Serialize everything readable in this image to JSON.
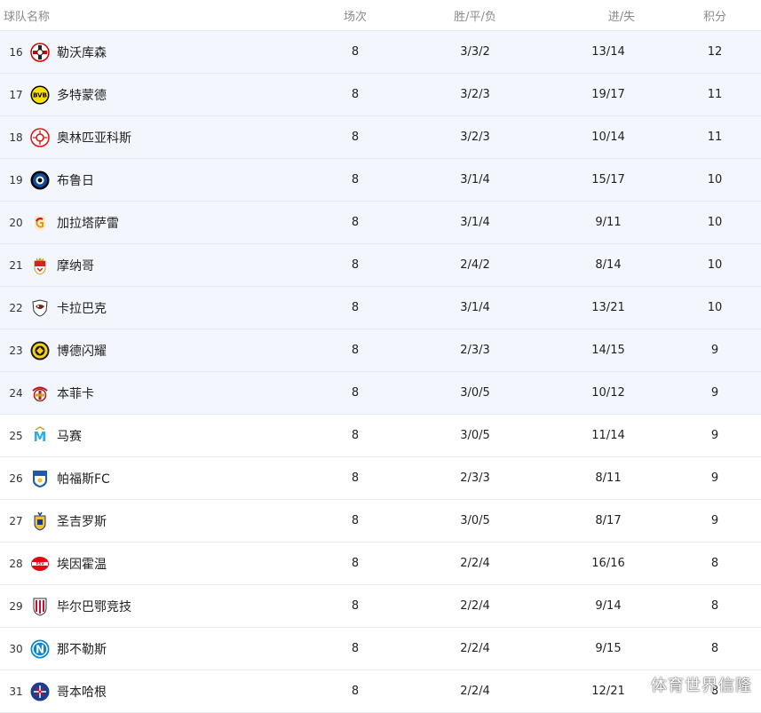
{
  "headers": {
    "team": "球队名称",
    "played": "场次",
    "wdl": "胜/平/负",
    "goals": "进/失",
    "points": "积分"
  },
  "rows": [
    {
      "rank": "16",
      "team": "勒沃库森",
      "played": "8",
      "wdl": "3/3/2",
      "goals": "13/14",
      "points": "12",
      "icon": "leverkusen-crest-icon",
      "highlight": true
    },
    {
      "rank": "17",
      "team": "多特蒙德",
      "played": "8",
      "wdl": "3/2/3",
      "goals": "19/17",
      "points": "11",
      "icon": "dortmund-crest-icon",
      "highlight": true
    },
    {
      "rank": "18",
      "team": "奥林匹亚科斯",
      "played": "8",
      "wdl": "3/2/3",
      "goals": "10/14",
      "points": "11",
      "icon": "olympiacos-crest-icon",
      "highlight": true
    },
    {
      "rank": "19",
      "team": "布鲁日",
      "played": "8",
      "wdl": "3/1/4",
      "goals": "15/17",
      "points": "10",
      "icon": "brugge-crest-icon",
      "highlight": true
    },
    {
      "rank": "20",
      "team": "加拉塔萨雷",
      "played": "8",
      "wdl": "3/1/4",
      "goals": "9/11",
      "points": "10",
      "icon": "galatasaray-crest-icon",
      "highlight": true
    },
    {
      "rank": "21",
      "team": "摩纳哥",
      "played": "8",
      "wdl": "2/4/2",
      "goals": "8/14",
      "points": "10",
      "icon": "monaco-crest-icon",
      "highlight": true
    },
    {
      "rank": "22",
      "team": "卡拉巴克",
      "played": "8",
      "wdl": "3/1/4",
      "goals": "13/21",
      "points": "10",
      "icon": "qarabag-crest-icon",
      "highlight": true
    },
    {
      "rank": "23",
      "team": "博德闪耀",
      "played": "8",
      "wdl": "2/3/3",
      "goals": "14/15",
      "points": "9",
      "icon": "bodo-glimt-crest-icon",
      "highlight": true
    },
    {
      "rank": "24",
      "team": "本菲卡",
      "played": "8",
      "wdl": "3/0/5",
      "goals": "10/12",
      "points": "9",
      "icon": "benfica-crest-icon",
      "highlight": true
    },
    {
      "rank": "25",
      "team": "马赛",
      "played": "8",
      "wdl": "3/0/5",
      "goals": "11/14",
      "points": "9",
      "icon": "marseille-crest-icon",
      "highlight": false
    },
    {
      "rank": "26",
      "team": "帕福斯FC",
      "played": "8",
      "wdl": "2/3/3",
      "goals": "8/11",
      "points": "9",
      "icon": "pafos-crest-icon",
      "highlight": false
    },
    {
      "rank": "27",
      "team": "圣吉罗斯",
      "played": "8",
      "wdl": "3/0/5",
      "goals": "8/17",
      "points": "9",
      "icon": "union-sg-crest-icon",
      "highlight": false
    },
    {
      "rank": "28",
      "team": "埃因霍温",
      "played": "8",
      "wdl": "2/2/4",
      "goals": "16/16",
      "points": "8",
      "icon": "psv-crest-icon",
      "highlight": false
    },
    {
      "rank": "29",
      "team": "毕尔巴鄂竞技",
      "played": "8",
      "wdl": "2/2/4",
      "goals": "9/14",
      "points": "8",
      "icon": "athletic-bilbao-crest-icon",
      "highlight": false
    },
    {
      "rank": "30",
      "team": "那不勒斯",
      "played": "8",
      "wdl": "2/2/4",
      "goals": "9/15",
      "points": "8",
      "icon": "napoli-crest-icon",
      "highlight": false
    },
    {
      "rank": "31",
      "team": "哥本哈根",
      "played": "8",
      "wdl": "2/2/4",
      "goals": "12/21",
      "points": "8",
      "icon": "copenhagen-crest-icon",
      "highlight": false
    }
  ],
  "watermark": "体育世界信隆",
  "colors": {
    "highlight_bg": "#f3f6fd",
    "border": "#e6e9ef",
    "header_text": "#8a8a8a"
  }
}
